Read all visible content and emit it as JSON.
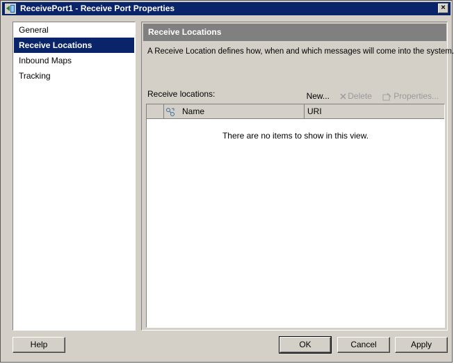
{
  "window": {
    "title": "ReceivePort1 - Receive Port Properties",
    "close_label": "×"
  },
  "nav": {
    "items": [
      {
        "label": "General",
        "selected": false
      },
      {
        "label": "Receive Locations",
        "selected": true
      },
      {
        "label": "Inbound Maps",
        "selected": false
      },
      {
        "label": "Tracking",
        "selected": false
      }
    ]
  },
  "content": {
    "header": "Receive Locations",
    "description": "A Receive Location defines how, when and which messages will come into the system.",
    "list_label": "Receive locations:",
    "toolbar": {
      "new_label": "New...",
      "delete_label": "Delete",
      "properties_label": "Properties..."
    },
    "columns": [
      "Name",
      "URI"
    ],
    "empty_message": "There are no items to show in this view."
  },
  "buttons": {
    "help": "Help",
    "ok": "OK",
    "cancel": "Cancel",
    "apply": "Apply"
  },
  "colors": {
    "titlebar": "#0a246a",
    "selection": "#0a246a",
    "section_header": "#808080",
    "dialog_bg": "#d4d0c8"
  }
}
